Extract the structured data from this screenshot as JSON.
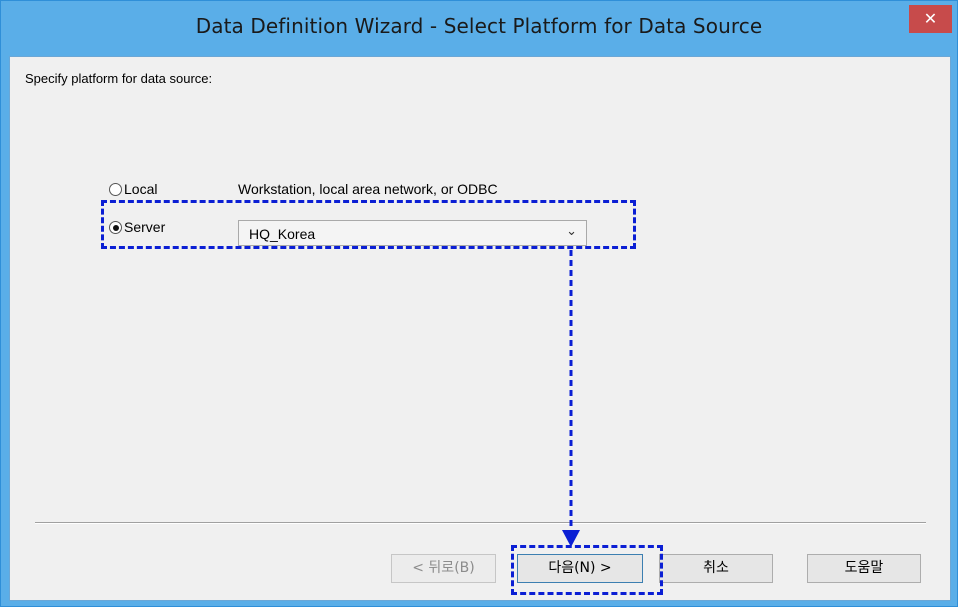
{
  "window": {
    "title": "Data Definition Wizard - Select Platform for Data Source",
    "close_glyph": "✕"
  },
  "prompt": "Specify platform for data source:",
  "options": {
    "local": {
      "label": "Local",
      "description": "Workstation, local area network, or ODBC",
      "checked": false
    },
    "server": {
      "label": "Server",
      "checked": true
    }
  },
  "server_combo": {
    "value": "HQ_Korea",
    "arrow_icon": "chevron-down"
  },
  "buttons": {
    "back": "< 뒤로(B)",
    "next": "다음(N) >",
    "cancel": "취소",
    "help": "도움말"
  },
  "annotation_color": "#0b1fd4"
}
